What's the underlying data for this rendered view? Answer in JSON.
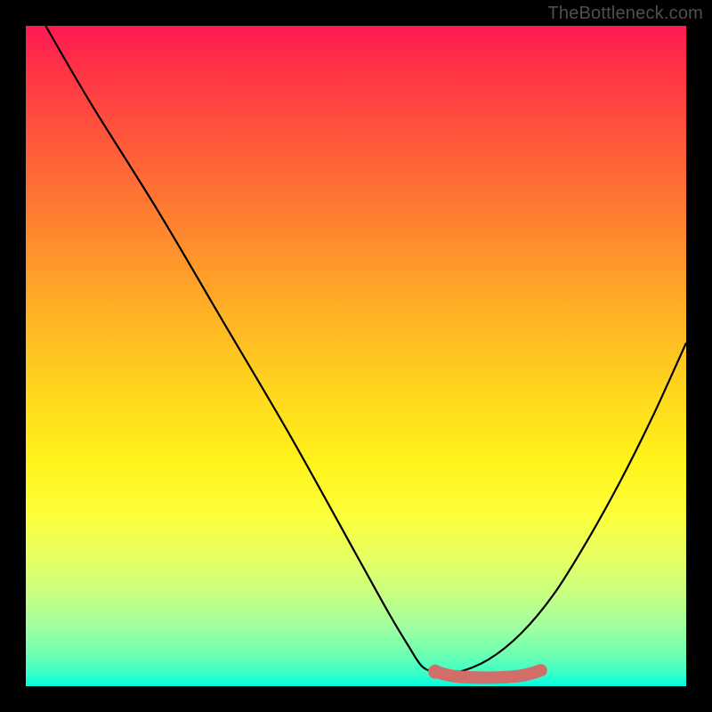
{
  "watermark": "TheBottleneck.com",
  "colors": {
    "frame_background": "#000000",
    "watermark_text": "#4f4f4f",
    "curve_stroke": "#000000",
    "marker": "#d26e69",
    "gradient_stops": [
      {
        "offset": 0.0,
        "color": "#ff1a52"
      },
      {
        "offset": 0.07,
        "color": "#ff3446"
      },
      {
        "offset": 0.18,
        "color": "#ff5a3a"
      },
      {
        "offset": 0.32,
        "color": "#ff8a2e"
      },
      {
        "offset": 0.44,
        "color": "#ffb324"
      },
      {
        "offset": 0.56,
        "color": "#ffd81e"
      },
      {
        "offset": 0.66,
        "color": "#fff31a"
      },
      {
        "offset": 0.74,
        "color": "#fdff3a"
      },
      {
        "offset": 0.8,
        "color": "#e8ff60"
      },
      {
        "offset": 0.86,
        "color": "#c8ff80"
      },
      {
        "offset": 0.91,
        "color": "#a0ffa0"
      },
      {
        "offset": 0.95,
        "color": "#70ffb0"
      },
      {
        "offset": 0.98,
        "color": "#3affc8"
      },
      {
        "offset": 1.0,
        "color": "#00ffe0"
      }
    ]
  },
  "chart_data": {
    "type": "line",
    "title": "",
    "xlabel": "",
    "ylabel": "",
    "xlim": [
      0,
      100
    ],
    "ylim": [
      0,
      100
    ],
    "series": [
      {
        "name": "left-descending-curve",
        "x": [
          3,
          10,
          20,
          30,
          40,
          50,
          55,
          58,
          60,
          62
        ],
        "y": [
          100,
          88,
          72,
          55,
          38,
          20,
          11,
          6,
          3,
          2
        ]
      },
      {
        "name": "right-ascending-curve",
        "x": [
          62,
          65,
          70,
          75,
          80,
          85,
          90,
          95,
          100
        ],
        "y": [
          2,
          2,
          4,
          8,
          14,
          22,
          31,
          41,
          52
        ]
      },
      {
        "name": "optimal-marker-band",
        "x": [
          62,
          65,
          70,
          75,
          78
        ],
        "y": [
          2.2,
          1.5,
          1.3,
          1.6,
          2.4
        ]
      }
    ],
    "annotations": [
      {
        "type": "point",
        "name": "optimal-start-dot",
        "x": 62,
        "y": 2.2
      }
    ]
  }
}
